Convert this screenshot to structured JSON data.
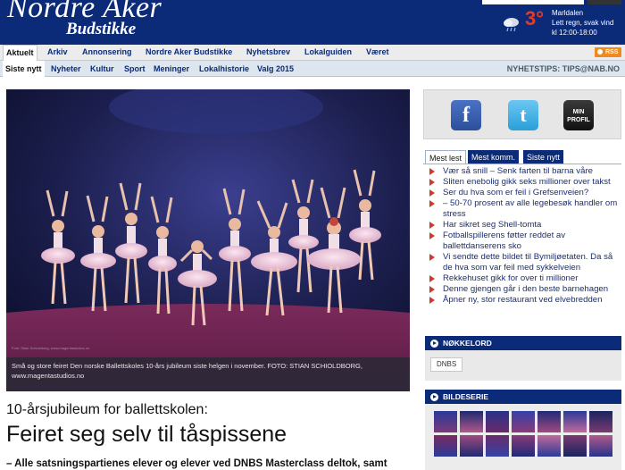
{
  "masthead": {
    "logo_main": "Nordre Aker",
    "logo_sub": "Budstikke",
    "weather_temp": "3°",
    "weather_lines": [
      "Marldalen",
      "Lett regn, svak vind",
      "kl 12:00-18:00"
    ]
  },
  "nav_main": {
    "items": [
      "Aktuelt",
      "Arkiv",
      "Annonsering",
      "Nordre Aker Budstikke",
      "Nyhetsbrev",
      "Lokalguiden",
      "Været"
    ],
    "rss": "RSS"
  },
  "nav_sub": {
    "items": [
      "Siste nytt",
      "Nyheter",
      "Kultur",
      "Sport",
      "Meninger",
      "Lokalhistorie",
      "Valg 2015"
    ],
    "tips": "NYHETSTIPS: TIPS@NAB.NO"
  },
  "hero": {
    "credit_small": "Foto: Stian Schioldborg, www.magentastudios.no",
    "caption": "Små og store feiret Den norske Ballettskoles 10-års jubileum siste helgen i november. FOTO: STIAN SCHIOLDBORG, www.magentastudios.no"
  },
  "article": {
    "kicker": "10-årsjubileum for ballettskolen:",
    "headline": "Feiret seg selv til tåspissene",
    "lead": "– Alle satsningspartienes elever og elever ved DNBS Masterclass deltok, samt"
  },
  "social": {
    "facebook_glyph": "f",
    "twitter_glyph": "t",
    "profile_label_1": "MIN",
    "profile_label_2": "PROFIL"
  },
  "tabs": [
    "Mest lest",
    "Mest komm.",
    "Siste nytt"
  ],
  "most_read": [
    "Vær så snill – Senk farten til barna våre",
    "Sliten enebolig gikk seks millioner over takst",
    "Ser du hva som er feil i Grefsenveien?",
    "– 50-70 prosent av alle legebesøk handler om stress",
    "Har sikret seg Shell-tomta",
    "Fotballspillerens føtter reddet av ballettdanserens sko",
    "Vi sendte dette bildet til Bymiljøetaten. Da så de hva som var feil med sykkelveien",
    "Rekkehuset gikk for over ti millioner",
    "Denne gjengen går i den beste barnehagen",
    "Åpner ny, stor restaurant ved elvebredden"
  ],
  "keywords": {
    "title": "NØKKELORD",
    "tags": [
      "DNBS"
    ]
  },
  "gallery": {
    "title": "BILDESERIE"
  },
  "colors": {
    "brand_blue": "#0b2a78",
    "accent_red": "#d03a2a",
    "rss_orange": "#f08a1c"
  }
}
